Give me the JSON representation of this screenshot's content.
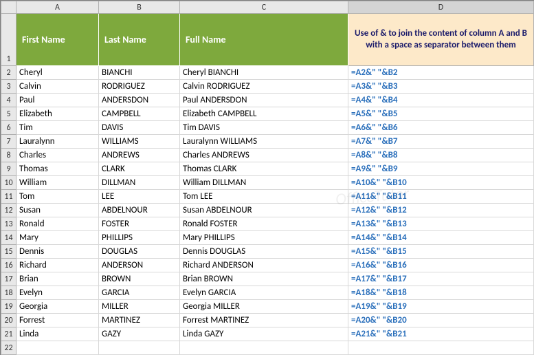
{
  "columns": {
    "corner": "",
    "A": "A",
    "B": "B",
    "C": "C",
    "D": "D"
  },
  "header": {
    "A": "First Name",
    "B": "Last Name",
    "C": "Full Name",
    "D": "Use of & to join the content of column A and B with a space as separator between them"
  },
  "rows": [
    {
      "n": "2",
      "A": "Cheryl",
      "B": "BIANCHI",
      "C": "Cheryl BIANCHI",
      "D": "=A2&\" \"&B2"
    },
    {
      "n": "3",
      "A": "Calvin",
      "B": "RODRIGUEZ",
      "C": "Calvin RODRIGUEZ",
      "D": "=A3&\" \"&B3"
    },
    {
      "n": "4",
      "A": "Paul",
      "B": "ANDERSDON",
      "C": "Paul ANDERSDON",
      "D": "=A4&\" \"&B4"
    },
    {
      "n": "5",
      "A": "Elizabeth",
      "B": "CAMPBELL",
      "C": "Elizabeth CAMPBELL",
      "D": "=A5&\" \"&B5"
    },
    {
      "n": "6",
      "A": "Tim",
      "B": "DAVIS",
      "C": "Tim DAVIS",
      "D": "=A6&\" \"&B6"
    },
    {
      "n": "7",
      "A": "Lauralynn",
      "B": "WILLIAMS",
      "C": "Lauralynn WILLIAMS",
      "D": "=A7&\" \"&B7"
    },
    {
      "n": "8",
      "A": "Charles",
      "B": "ANDREWS",
      "C": "Charles ANDREWS",
      "D": "=A8&\" \"&B8"
    },
    {
      "n": "9",
      "A": "Thomas",
      "B": "CLARK",
      "C": "Thomas CLARK",
      "D": "=A9&\" \"&B9"
    },
    {
      "n": "10",
      "A": "William",
      "B": "DILLMAN",
      "C": "William DILLMAN",
      "D": "=A10&\" \"&B10"
    },
    {
      "n": "11",
      "A": "Tom",
      "B": "LEE",
      "C": "Tom LEE",
      "D": "=A11&\" \"&B11"
    },
    {
      "n": "12",
      "A": "Susan",
      "B": "ABDELNOUR",
      "C": "Susan ABDELNOUR",
      "D": "=A12&\" \"&B12"
    },
    {
      "n": "13",
      "A": "Ronald",
      "B": "FOSTER",
      "C": "Ronald FOSTER",
      "D": "=A13&\" \"&B13"
    },
    {
      "n": "14",
      "A": "Mary",
      "B": "PHILLIPS",
      "C": "Mary PHILLIPS",
      "D": "=A14&\" \"&B14"
    },
    {
      "n": "15",
      "A": "Dennis",
      "B": "DOUGLAS",
      "C": "Dennis DOUGLAS",
      "D": "=A15&\" \"&B15"
    },
    {
      "n": "16",
      "A": "Richard",
      "B": "ANDERSON",
      "C": "Richard ANDERSON",
      "D": "=A16&\" \"&B16"
    },
    {
      "n": "17",
      "A": "Brian",
      "B": "BROWN",
      "C": "Brian BROWN",
      "D": "=A17&\" \"&B17"
    },
    {
      "n": "18",
      "A": "Evelyn",
      "B": "GARCIA",
      "C": "Evelyn GARCIA",
      "D": "=A18&\" \"&B18"
    },
    {
      "n": "19",
      "A": "Georgia",
      "B": "MILLER",
      "C": "Georgia MILLER",
      "D": "=A19&\" \"&B19"
    },
    {
      "n": "20",
      "A": "Forrest",
      "B": "MARTINEZ",
      "C": "Forrest MARTINEZ",
      "D": "=A20&\" \"&B20"
    },
    {
      "n": "21",
      "A": "Linda",
      "B": "GAZY",
      "C": "Linda GAZY",
      "D": "=A21&\" \"&B21"
    }
  ],
  "watermark": "OfficeTutor"
}
